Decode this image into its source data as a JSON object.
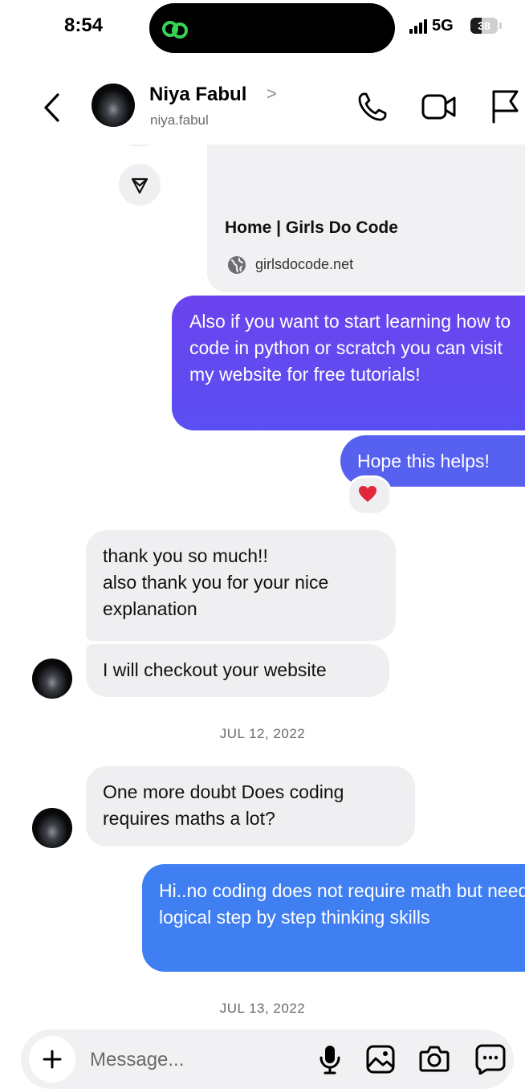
{
  "status_bar": {
    "time": "8:54",
    "network": "5G",
    "battery": "38"
  },
  "header": {
    "name": "Niya Fabul",
    "chevron": ">",
    "username": "niya.fabul",
    "icons": [
      "phone-icon",
      "video-camera-icon",
      "flag-icon"
    ]
  },
  "link_card": {
    "title": "Home | Girls Do Code",
    "domain": "girlsdocode.net"
  },
  "messages": {
    "out1": "Also if you want to start learning how to code in python or scratch you can visit my website for free tutorials!",
    "out2": "Hope this helps!",
    "in1": "thank you so much!!\nalso thank you for your nice explanation",
    "in2": "I will checkout your website",
    "in3": "One more doubt Does coding requires maths a lot?",
    "out3": "Hi..no coding does not require math but needs logical step by step thinking skills"
  },
  "dates": {
    "d1": "JUL 12, 2022",
    "d2": "JUL 13, 2022"
  },
  "composer": {
    "placeholder": "Message..."
  },
  "colors": {
    "outgoing_gradient_top": "#6b43ee",
    "outgoing_mid": "#5661f0",
    "outgoing_blue": "#3f7ff2",
    "incoming": "#efeff1"
  }
}
